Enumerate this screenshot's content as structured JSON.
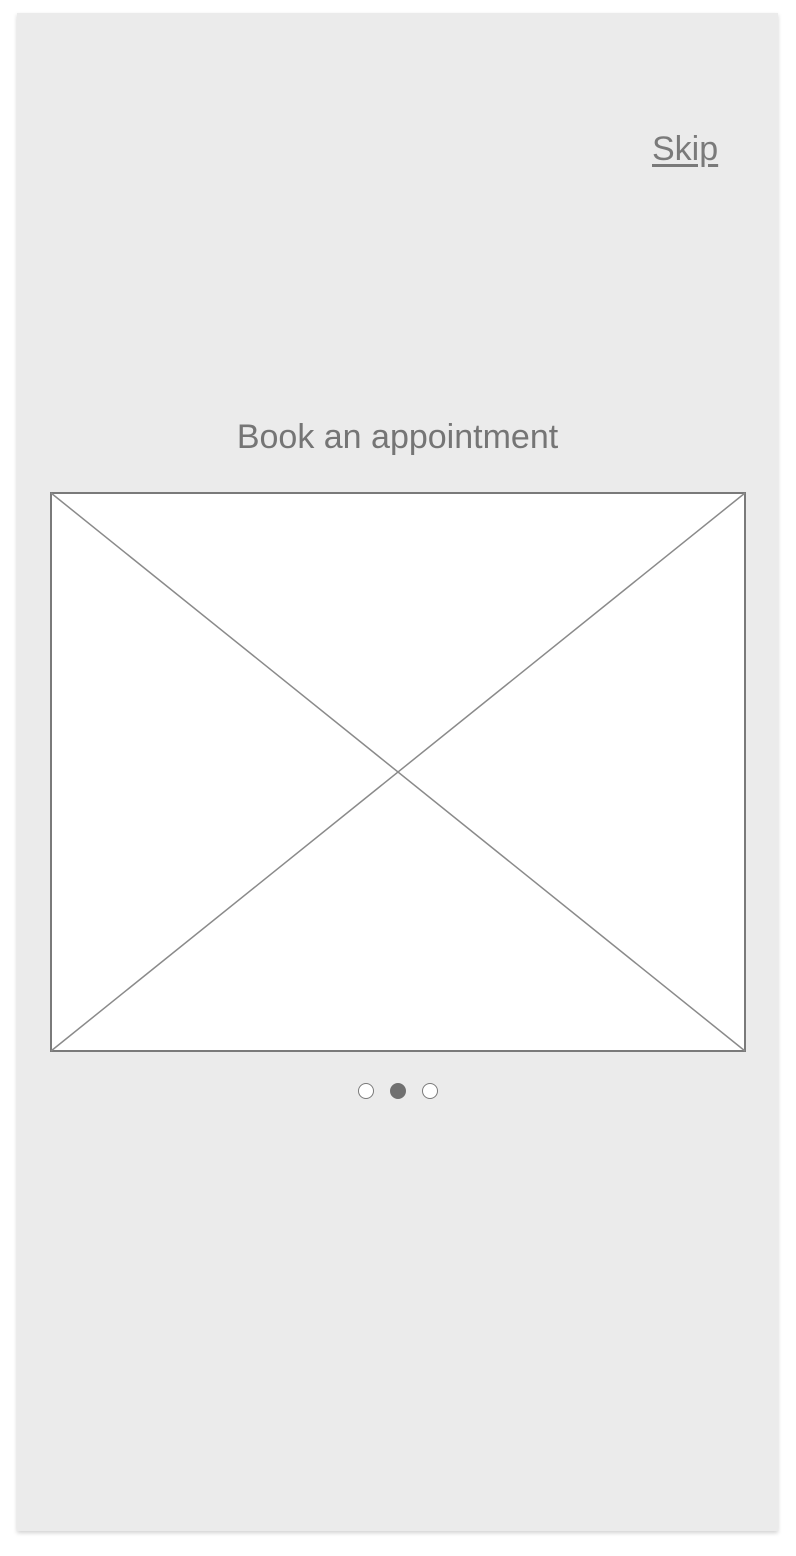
{
  "header": {
    "skip_label": "Skip"
  },
  "onboarding": {
    "title": "Book an appointment",
    "image_icon": "image-placeholder-icon",
    "pagination": {
      "total": 3,
      "active_index": 1
    }
  },
  "colors": {
    "screen_background": "#ebebeb",
    "text": "#757575",
    "placeholder_stroke": "#8a8a8a",
    "dot_active": "#707070"
  }
}
